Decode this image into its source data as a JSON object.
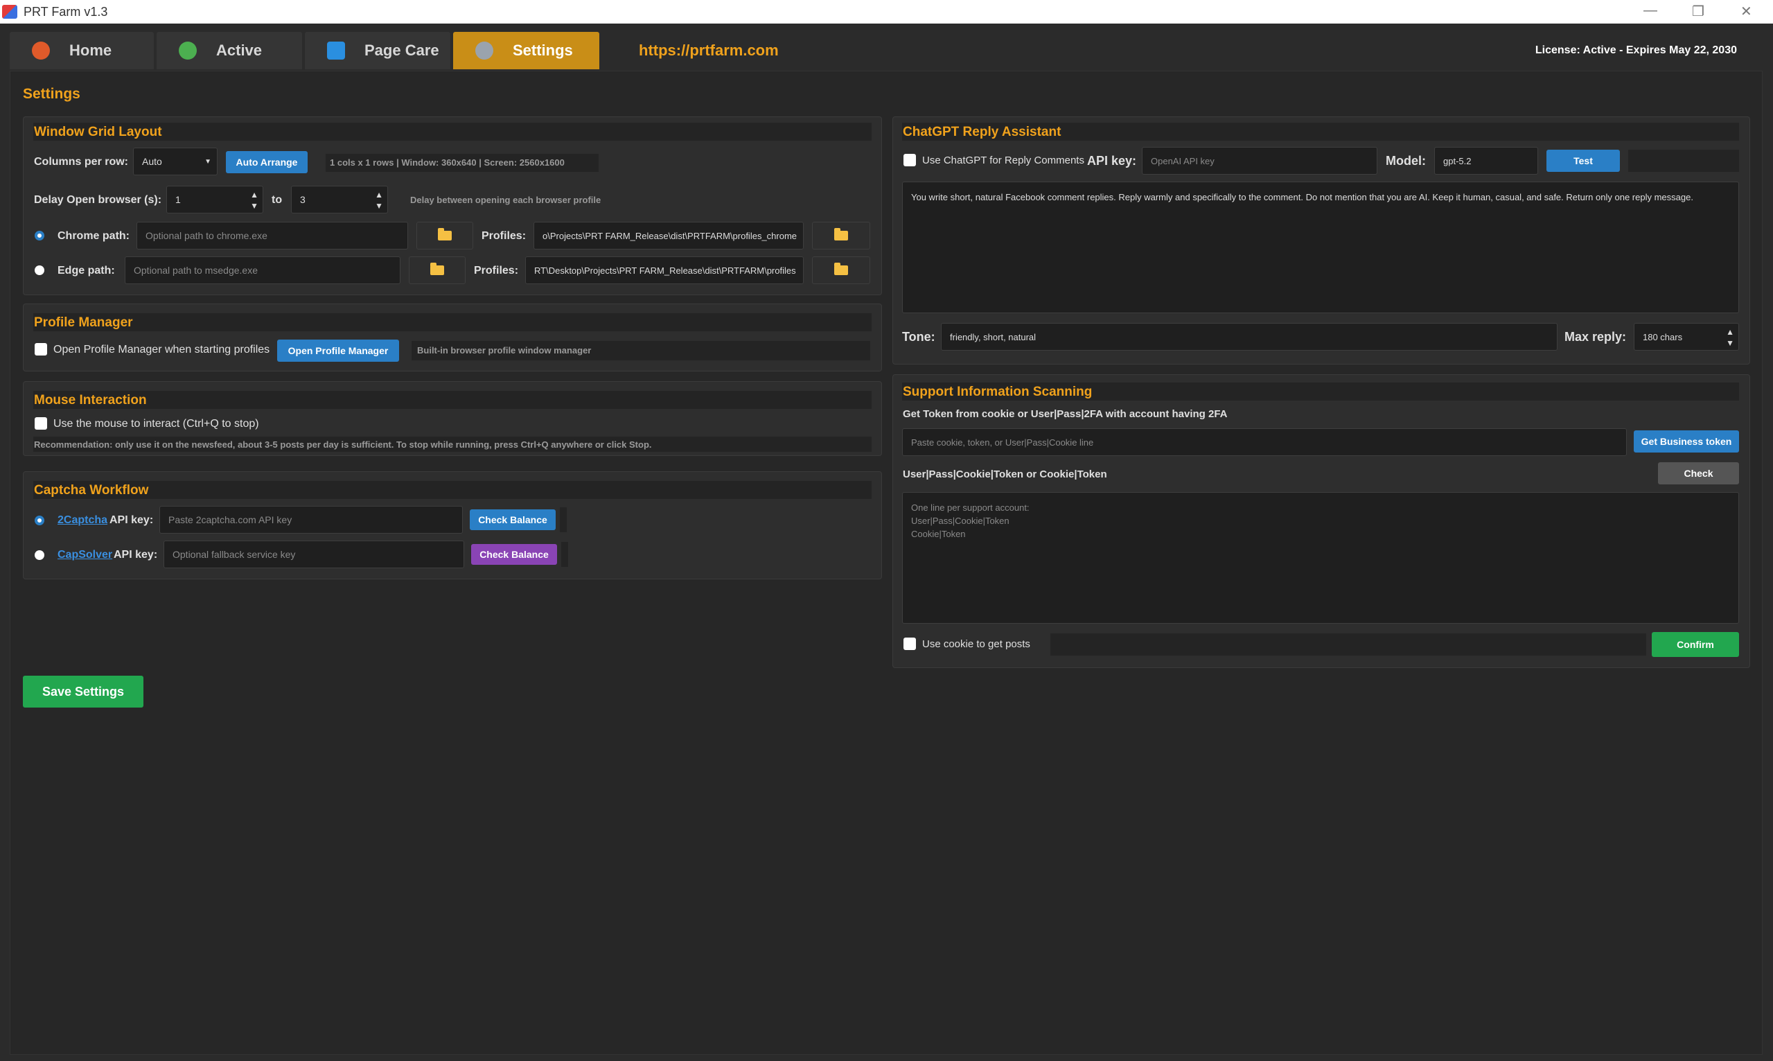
{
  "window": {
    "title": "PRT Farm v1.3",
    "controls": [
      "—",
      "❐",
      "✕"
    ]
  },
  "tabs": [
    {
      "label": "Home",
      "icon": "home-icon",
      "color": "#e05a2a"
    },
    {
      "label": "Active",
      "icon": "active-icon",
      "color": "#4caf50"
    },
    {
      "label": "Page Care",
      "icon": "info-icon",
      "color": "#2a8fe0"
    },
    {
      "label": "Settings",
      "icon": "gear-icon",
      "color": "#9aa3ad"
    }
  ],
  "header": {
    "link": "https://prtfarm.com",
    "license": "License: Active - Expires May 22, 2030"
  },
  "page_title": "Settings",
  "grid": {
    "title": "Window Grid Layout",
    "columns_label": "Columns per row:",
    "columns_value": "Auto",
    "auto_arrange": "Auto Arrange",
    "info": "1 cols x 1 rows  |  Window: 360x640  |  Screen: 2560x1600",
    "delay_label": "Delay Open browser (s):",
    "delay_from": "1",
    "delay_to_label": "to",
    "delay_to": "3",
    "delay_hint": "Delay between opening each browser profile",
    "chrome_label": "Chrome path:",
    "chrome_placeholder": "Optional path to chrome.exe",
    "profiles_label": "Profiles:",
    "chrome_profiles": "o\\Projects\\PRT FARM_Release\\dist\\PRTFARM\\profiles_chrome",
    "edge_label": "Edge path:",
    "edge_placeholder": "Optional path to msedge.exe",
    "edge_profiles": "RT\\Desktop\\Projects\\PRT FARM_Release\\dist\\PRTFARM\\profiles"
  },
  "profile_manager": {
    "title": "Profile Manager",
    "checkbox_label": "Open Profile Manager when starting profiles",
    "button": "Open Profile Manager",
    "hint": "Built-in browser profile window manager"
  },
  "mouse": {
    "title": "Mouse Interaction",
    "checkbox_label": "Use the mouse to interact (Ctrl+Q to stop)",
    "recommendation": "Recommendation: only use it on the newsfeed, about 3-5 posts per day is sufficient. To stop while running, press Ctrl+Q anywhere or click Stop."
  },
  "captcha": {
    "title": "Captcha Workflow",
    "twocaptcha_link": "2Captcha",
    "api_key_label": "API key:",
    "twocaptcha_placeholder": "Paste 2captcha.com API key",
    "check_balance": "Check Balance",
    "capsolver_link": "CapSolver",
    "capsolver_placeholder": "Optional fallback service key"
  },
  "save_button": "Save Settings",
  "chatgpt": {
    "title": "ChatGPT Reply Assistant",
    "use_label": "Use ChatGPT for Reply Comments",
    "api_key_label": "API key:",
    "api_key_placeholder": "OpenAI API key",
    "model_label": "Model:",
    "model_value": "gpt-5.2",
    "test": "Test",
    "prompt": "You write short, natural Facebook comment replies. Reply warmly and specifically to the comment. Do not mention that you are AI. Keep it human, casual, and safe. Return only one reply message.",
    "tone_label": "Tone:",
    "tone_value": "friendly, short, natural",
    "max_reply_label": "Max reply:",
    "max_reply_value": "180 chars"
  },
  "support": {
    "title": "Support Information Scanning",
    "token_label": "Get Token from cookie or User|Pass|2FA with account having 2FA",
    "token_placeholder": "Paste cookie, token, or User|Pass|Cookie line",
    "get_token": "Get Business token",
    "format_label": "User|Pass|Cookie|Token or Cookie|Token",
    "check": "Check",
    "list_placeholder": "One line per support account:\nUser|Pass|Cookie|Token\nCookie|Token",
    "use_cookie_label": "Use cookie to get posts",
    "confirm": "Confirm"
  }
}
